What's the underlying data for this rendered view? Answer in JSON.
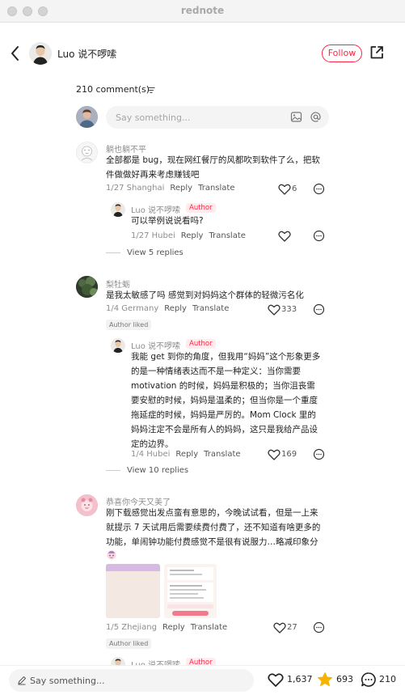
{
  "window": {
    "title": "rednote"
  },
  "header": {
    "author_name": "Luo 说不啰嗦",
    "follow_label": "Follow"
  },
  "comments_header": {
    "count_label": "210 comment(s)"
  },
  "comment_input": {
    "placeholder": "Say something..."
  },
  "comments": [
    {
      "username": "躺也躺不平",
      "lines": [
        "全部都是 bug，现在网红餐厅的风都吹到软件了么，把软",
        "件做做好再来考虑赚钱吧"
      ],
      "date_location": "1/27 Shanghai",
      "reply_label": "Reply",
      "translate_label": "Translate",
      "likes": "6",
      "reply": {
        "username": "Luo 说不啰嗦",
        "badge": "Author",
        "lines": [
          "可以举例说说看吗?"
        ],
        "date_location": "1/27 Hubei",
        "reply_label": "Reply",
        "translate_label": "Translate"
      },
      "view_more": "View 5 replies"
    },
    {
      "username": "梨牡蛎",
      "lines": [
        "是我太敏感了吗 感觉到对妈妈这个群体的轻微污名化"
      ],
      "date_location": "1/4 Germany",
      "reply_label": "Reply",
      "translate_label": "Translate",
      "likes": "333",
      "badge": "Author liked",
      "reply": {
        "username": "Luo 说不啰嗦",
        "badge": "Author",
        "lines": [
          "我能 get 到你的角度，但我用“妈妈”这个形象更多",
          "的是一种情绪表达而不是一种定义：当你需要",
          "motivation 的时候，妈妈是积极的；当你沮丧需",
          "要安慰的时候，妈妈是温柔的；但当你是一个重度",
          "拖延症的时候，妈妈是严厉的。Mom Clock 里的",
          "妈妈注定不会是所有人的妈妈，这只是我给产品设",
          "定的边界。"
        ],
        "date_location": "1/4 Hubei",
        "reply_label": "Reply",
        "translate_label": "Translate",
        "likes": "169"
      },
      "view_more": "View 10 replies"
    },
    {
      "username": "恭喜你今天又美了",
      "lines": [
        "刚下载感觉出发点蛮有意思的，今晚试试看，但是一上来",
        "就提示 7 天试用后需要续费付费了，还不知道有啥更多的",
        "功能，单闹钟功能付费感觉不是很有说服力…略减印象分"
      ],
      "date_location": "1/5 Zhejiang",
      "reply_label": "Reply",
      "translate_label": "Translate",
      "likes": "27",
      "badge": "Author liked",
      "partial_reply_username": "Luo 说不啰嗦",
      "partial_reply_badge": "Author"
    }
  ],
  "bottom_bar": {
    "placeholder": "Say something...",
    "likes": "1,637",
    "collects": "693",
    "comments": "210"
  },
  "colors": {
    "accent": "#ff2442",
    "collect_star": "#f5b400"
  },
  "icons": [
    "back-arrow-icon",
    "share-icon",
    "sort-icon",
    "image-icon",
    "mention-icon",
    "heart-icon",
    "reply-bubble-icon",
    "pencil-icon",
    "star-icon",
    "comment-icon"
  ]
}
